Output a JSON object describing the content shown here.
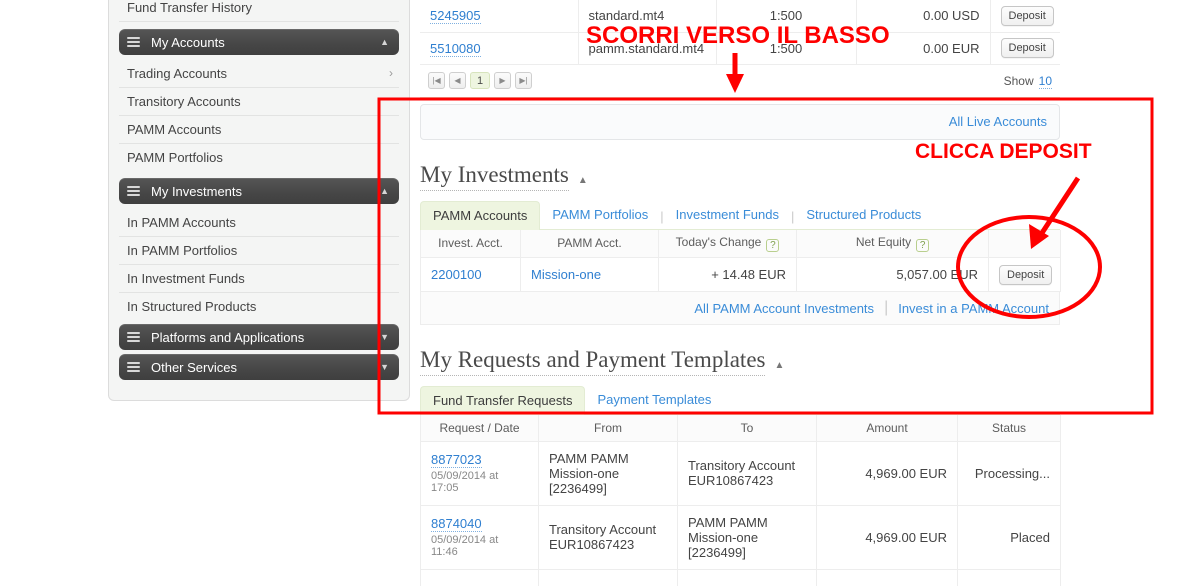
{
  "sidebar": {
    "top_link": "Fund Transfer History",
    "sections": [
      {
        "title": "My Accounts",
        "expanded_icon": "▲",
        "items": [
          "Trading Accounts",
          "Transitory Accounts",
          "PAMM Accounts",
          "PAMM Portfolios"
        ]
      },
      {
        "title": "My Investments",
        "expanded_icon": "▲",
        "items": [
          "In PAMM Accounts",
          "In PAMM Portfolios",
          "In Investment Funds",
          "In Structured Products"
        ]
      }
    ],
    "collapsed_sections": [
      {
        "title": "Platforms and Applications",
        "collapsed_icon": "▼"
      },
      {
        "title": "Other Services",
        "collapsed_icon": "▼"
      }
    ],
    "chevron": "›"
  },
  "top_accounts_table": {
    "rows": [
      {
        "account": "5245905",
        "type": "standard.mt4",
        "leverage": "1:500",
        "balance": "0.00 USD",
        "action": "Deposit"
      },
      {
        "account": "5510080",
        "type": "pamm.standard.mt4",
        "leverage": "1:500",
        "balance": "0.00 EUR",
        "action": "Deposit"
      }
    ],
    "pagination": {
      "first": "|◀",
      "prev": "◀",
      "page": "1",
      "next": "▶",
      "last": "▶|",
      "show_label": "Show",
      "show_value": "10"
    },
    "all_live_accounts_link": "All Live Accounts"
  },
  "investments": {
    "heading": "My Investments",
    "collapse_icon": "▲",
    "tabs": [
      {
        "label": "PAMM Accounts",
        "active": true
      },
      {
        "label": "PAMM Portfolios",
        "active": false
      },
      {
        "label": "Investment Funds",
        "active": false
      },
      {
        "label": "Structured Products",
        "active": false
      }
    ],
    "columns": [
      "Invest. Acct.",
      "PAMM Acct.",
      "Today's Change",
      "Net Equity",
      ""
    ],
    "help_icon": "?",
    "rows": [
      {
        "invest_acct": "2200100",
        "pamm_acct": "Mission-one",
        "todays_change": "+ 14.48 EUR",
        "net_equity": "5,057.00 EUR",
        "action": "Deposit"
      }
    ],
    "footer_links": [
      "All PAMM Account Investments",
      "Invest in a PAMM Account"
    ],
    "footer_separator": "|"
  },
  "requests": {
    "heading": "My Requests and Payment Templates",
    "collapse_icon": "▲",
    "tabs": [
      {
        "label": "Fund Transfer Requests",
        "active": true
      },
      {
        "label": "Payment Templates",
        "active": false
      }
    ],
    "columns": [
      "Request / Date",
      "From",
      "To",
      "Amount",
      "Status"
    ],
    "rows": [
      {
        "request_id": "8877023",
        "date": "05/09/2014 at 17:05",
        "from": "PAMM PAMM\nMission-one\n[2236499]",
        "to": "Transitory Account\nEUR10867423",
        "amount": "4,969.00 EUR",
        "status": "Processing...",
        "status_kind": "processing"
      },
      {
        "request_id": "8874040",
        "date": "05/09/2014 at 11:46",
        "from": "Transitory Account\nEUR10867423",
        "to": "PAMM PAMM\nMission-one\n[2236499]",
        "amount": "4,969.00 EUR",
        "status": "Placed",
        "status_kind": "placed"
      }
    ]
  },
  "annotations": {
    "scroll_text": "SCORRI VERSO IL BASSO",
    "deposit_text": "CLICCA DEPOSIT",
    "color": "#fe0000"
  }
}
